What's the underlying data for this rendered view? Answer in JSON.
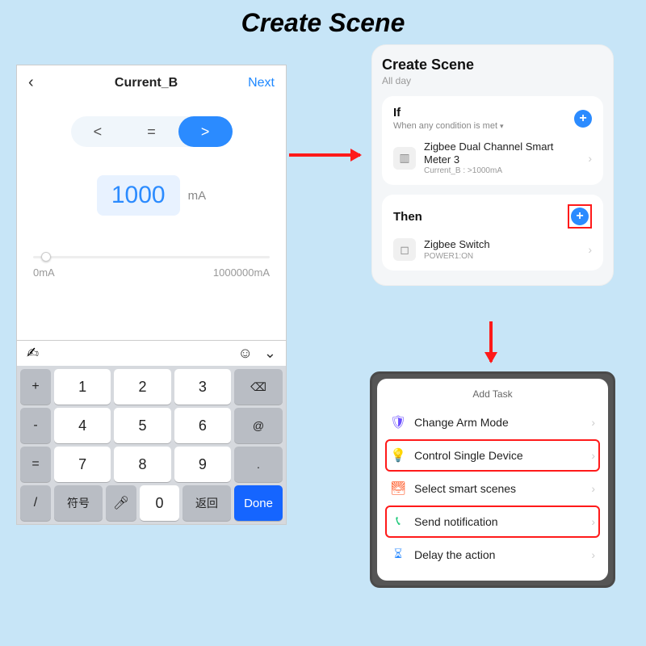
{
  "page": {
    "title": "Create Scene"
  },
  "panel1": {
    "title": "Current_B",
    "next": "Next",
    "ops": {
      "lt": "<",
      "eq": "=",
      "gt": ">"
    },
    "value": "1000",
    "unit": "mA",
    "slider": {
      "min": "0mA",
      "max": "1000000mA"
    },
    "keys": {
      "plus": "+",
      "minus": "-",
      "eq": "=",
      "slash": "/",
      "k1": "1",
      "k2": "2",
      "k3": "3",
      "k4": "4",
      "k5": "5",
      "k6": "6",
      "k7": "7",
      "k8": "8",
      "k9": "9",
      "k0": "0",
      "back": "⌫",
      "at": "@",
      "dot": ".",
      "sym": "符号",
      "ret": "返回",
      "done": "Done"
    }
  },
  "panel2": {
    "title": "Create Scene",
    "subtitle": "All day",
    "if": {
      "heading": "If",
      "cond": "When any condition is met",
      "device": {
        "name": "Zigbee Dual Channel Smart Meter 3",
        "state": "Current_B : >1000mA"
      }
    },
    "then": {
      "heading": "Then",
      "device": {
        "name": "Zigbee Switch",
        "state": "POWER1:ON"
      }
    }
  },
  "panel3": {
    "title": "Add Task",
    "tasks": {
      "arm": "Change Arm Mode",
      "control": "Control Single Device",
      "scenes": "Select smart scenes",
      "notify": "Send notification",
      "delay": "Delay the action"
    }
  }
}
